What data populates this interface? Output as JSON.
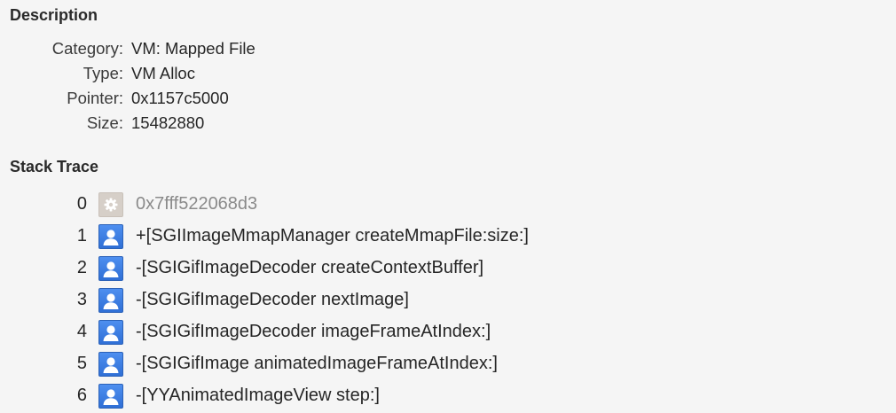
{
  "description": {
    "title": "Description",
    "fields": [
      {
        "key": "Category:",
        "value": "VM: Mapped File"
      },
      {
        "key": "Type:",
        "value": "VM Alloc"
      },
      {
        "key": "Pointer:",
        "value": "0x1157c5000"
      },
      {
        "key": "Size:",
        "value": "15482880"
      }
    ]
  },
  "stack_trace": {
    "title": "Stack Trace",
    "frames": [
      {
        "index": "0",
        "icon": "gear-icon",
        "kind": "system",
        "symbol": "0x7fff522068d3"
      },
      {
        "index": "1",
        "icon": "user-icon",
        "kind": "user",
        "symbol": "+[SGIImageMmapManager createMmapFile:size:]"
      },
      {
        "index": "2",
        "icon": "user-icon",
        "kind": "user",
        "symbol": "-[SGIGifImageDecoder createContextBuffer]"
      },
      {
        "index": "3",
        "icon": "user-icon",
        "kind": "user",
        "symbol": "-[SGIGifImageDecoder nextImage]"
      },
      {
        "index": "4",
        "icon": "user-icon",
        "kind": "user",
        "symbol": "-[SGIGifImageDecoder imageFrameAtIndex:]"
      },
      {
        "index": "5",
        "icon": "user-icon",
        "kind": "user",
        "symbol": "-[SGIGifImage animatedImageFrameAtIndex:]"
      },
      {
        "index": "6",
        "icon": "user-icon",
        "kind": "user",
        "symbol": "-[YYAnimatedImageView step:]"
      }
    ]
  },
  "colors": {
    "background": "#f5f5f5",
    "user_icon": "#3b7de3",
    "system_icon": "#d6cfc8",
    "dim_text": "#8a8a8a"
  }
}
